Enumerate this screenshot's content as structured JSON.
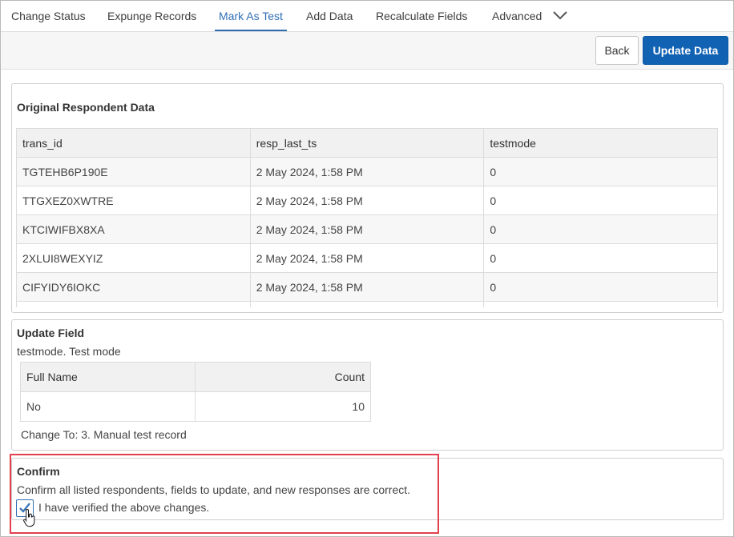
{
  "tabs": [
    {
      "label": "Change Status"
    },
    {
      "label": "Expunge Records"
    },
    {
      "label": "Mark As Test"
    },
    {
      "label": "Add Data"
    },
    {
      "label": "Recalculate Fields"
    },
    {
      "label": "Advanced"
    }
  ],
  "active_tab": "Mark As Test",
  "toolbar": {
    "back_label": "Back",
    "update_label": "Update Data"
  },
  "original": {
    "title": "Original Respondent Data",
    "headers": [
      "trans_id",
      "resp_last_ts",
      "testmode"
    ],
    "rows": [
      [
        "TGTEHB6P190E",
        "2 May 2024, 1:58 PM",
        "0"
      ],
      [
        "TTGXEZ0XWTRE",
        "2 May 2024, 1:58 PM",
        "0"
      ],
      [
        "KTCIWIFBX8XA",
        "2 May 2024, 1:58 PM",
        "0"
      ],
      [
        "2XLUI8WEXYIZ",
        "2 May 2024, 1:58 PM",
        "0"
      ],
      [
        "CIFYIDY6IOKC",
        "2 May 2024, 1:58 PM",
        "0"
      ]
    ]
  },
  "update_field": {
    "title": "Update Field",
    "field": "testmode. Test mode",
    "headers": [
      "Full Name",
      "Count"
    ],
    "rows": [
      [
        "No",
        "10"
      ]
    ],
    "change_to": "Change To: 3. Manual test record"
  },
  "confirm": {
    "title": "Confirm",
    "message": "Confirm all listed respondents, fields to update, and new responses are correct.",
    "checkbox_label": "I have verified the above changes.",
    "checked": true
  },
  "colors": {
    "accent": "#2f6eb5",
    "primary_button": "#1262b3",
    "highlight": "#e2404f"
  }
}
